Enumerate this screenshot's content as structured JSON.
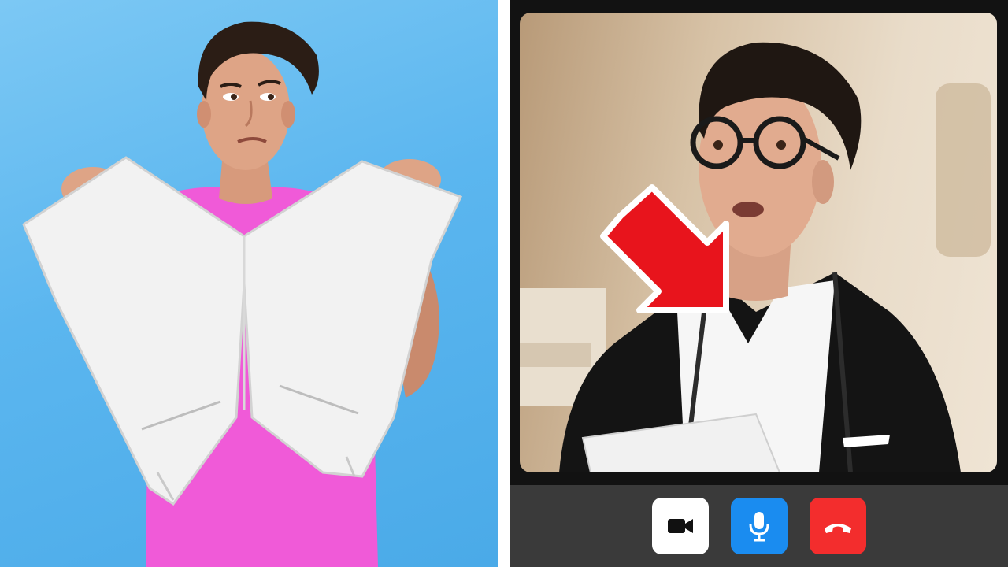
{
  "call_controls": {
    "camera": {
      "icon": "video-camera-icon",
      "background": "#ffffff",
      "icon_color": "#111111"
    },
    "microphone": {
      "icon": "microphone-icon",
      "background": "#1a8cf0",
      "icon_color": "#ffffff"
    },
    "end_call": {
      "icon": "phone-hangup-icon",
      "background": "#f32d2d",
      "icon_color": "#ffffff"
    }
  },
  "colors": {
    "left_background": "#5bb6ef",
    "shirt_pink": "#f05ad8",
    "shorts_white": "#f2f2f2",
    "arrow_red": "#e8141c",
    "control_bar": "#3a3a3a",
    "window_frame": "#121212"
  }
}
